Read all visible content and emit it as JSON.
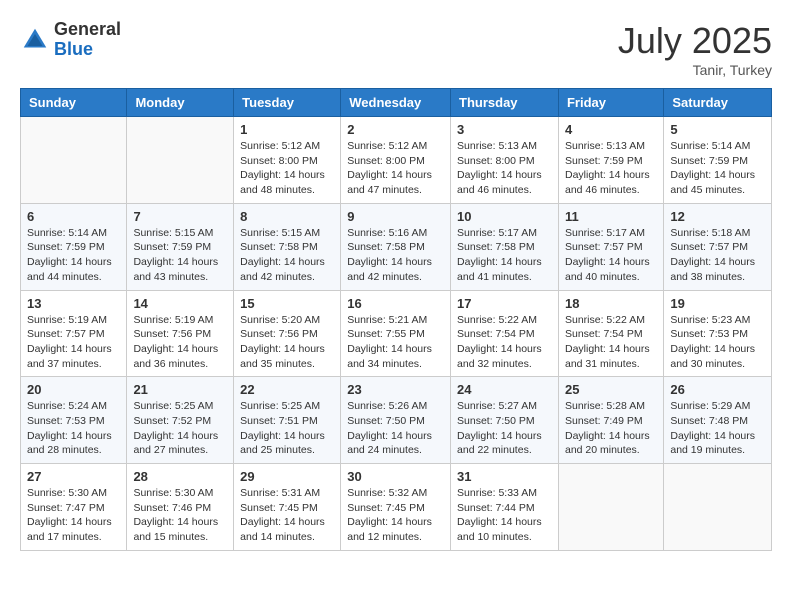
{
  "logo": {
    "general": "General",
    "blue": "Blue"
  },
  "title": {
    "month_year": "July 2025",
    "location": "Tanir, Turkey"
  },
  "headers": [
    "Sunday",
    "Monday",
    "Tuesday",
    "Wednesday",
    "Thursday",
    "Friday",
    "Saturday"
  ],
  "weeks": [
    [
      {
        "day": "",
        "info": ""
      },
      {
        "day": "",
        "info": ""
      },
      {
        "day": "1",
        "info": "Sunrise: 5:12 AM\nSunset: 8:00 PM\nDaylight: 14 hours and 48 minutes."
      },
      {
        "day": "2",
        "info": "Sunrise: 5:12 AM\nSunset: 8:00 PM\nDaylight: 14 hours and 47 minutes."
      },
      {
        "day": "3",
        "info": "Sunrise: 5:13 AM\nSunset: 8:00 PM\nDaylight: 14 hours and 46 minutes."
      },
      {
        "day": "4",
        "info": "Sunrise: 5:13 AM\nSunset: 7:59 PM\nDaylight: 14 hours and 46 minutes."
      },
      {
        "day": "5",
        "info": "Sunrise: 5:14 AM\nSunset: 7:59 PM\nDaylight: 14 hours and 45 minutes."
      }
    ],
    [
      {
        "day": "6",
        "info": "Sunrise: 5:14 AM\nSunset: 7:59 PM\nDaylight: 14 hours and 44 minutes."
      },
      {
        "day": "7",
        "info": "Sunrise: 5:15 AM\nSunset: 7:59 PM\nDaylight: 14 hours and 43 minutes."
      },
      {
        "day": "8",
        "info": "Sunrise: 5:15 AM\nSunset: 7:58 PM\nDaylight: 14 hours and 42 minutes."
      },
      {
        "day": "9",
        "info": "Sunrise: 5:16 AM\nSunset: 7:58 PM\nDaylight: 14 hours and 42 minutes."
      },
      {
        "day": "10",
        "info": "Sunrise: 5:17 AM\nSunset: 7:58 PM\nDaylight: 14 hours and 41 minutes."
      },
      {
        "day": "11",
        "info": "Sunrise: 5:17 AM\nSunset: 7:57 PM\nDaylight: 14 hours and 40 minutes."
      },
      {
        "day": "12",
        "info": "Sunrise: 5:18 AM\nSunset: 7:57 PM\nDaylight: 14 hours and 38 minutes."
      }
    ],
    [
      {
        "day": "13",
        "info": "Sunrise: 5:19 AM\nSunset: 7:57 PM\nDaylight: 14 hours and 37 minutes."
      },
      {
        "day": "14",
        "info": "Sunrise: 5:19 AM\nSunset: 7:56 PM\nDaylight: 14 hours and 36 minutes."
      },
      {
        "day": "15",
        "info": "Sunrise: 5:20 AM\nSunset: 7:56 PM\nDaylight: 14 hours and 35 minutes."
      },
      {
        "day": "16",
        "info": "Sunrise: 5:21 AM\nSunset: 7:55 PM\nDaylight: 14 hours and 34 minutes."
      },
      {
        "day": "17",
        "info": "Sunrise: 5:22 AM\nSunset: 7:54 PM\nDaylight: 14 hours and 32 minutes."
      },
      {
        "day": "18",
        "info": "Sunrise: 5:22 AM\nSunset: 7:54 PM\nDaylight: 14 hours and 31 minutes."
      },
      {
        "day": "19",
        "info": "Sunrise: 5:23 AM\nSunset: 7:53 PM\nDaylight: 14 hours and 30 minutes."
      }
    ],
    [
      {
        "day": "20",
        "info": "Sunrise: 5:24 AM\nSunset: 7:53 PM\nDaylight: 14 hours and 28 minutes."
      },
      {
        "day": "21",
        "info": "Sunrise: 5:25 AM\nSunset: 7:52 PM\nDaylight: 14 hours and 27 minutes."
      },
      {
        "day": "22",
        "info": "Sunrise: 5:25 AM\nSunset: 7:51 PM\nDaylight: 14 hours and 25 minutes."
      },
      {
        "day": "23",
        "info": "Sunrise: 5:26 AM\nSunset: 7:50 PM\nDaylight: 14 hours and 24 minutes."
      },
      {
        "day": "24",
        "info": "Sunrise: 5:27 AM\nSunset: 7:50 PM\nDaylight: 14 hours and 22 minutes."
      },
      {
        "day": "25",
        "info": "Sunrise: 5:28 AM\nSunset: 7:49 PM\nDaylight: 14 hours and 20 minutes."
      },
      {
        "day": "26",
        "info": "Sunrise: 5:29 AM\nSunset: 7:48 PM\nDaylight: 14 hours and 19 minutes."
      }
    ],
    [
      {
        "day": "27",
        "info": "Sunrise: 5:30 AM\nSunset: 7:47 PM\nDaylight: 14 hours and 17 minutes."
      },
      {
        "day": "28",
        "info": "Sunrise: 5:30 AM\nSunset: 7:46 PM\nDaylight: 14 hours and 15 minutes."
      },
      {
        "day": "29",
        "info": "Sunrise: 5:31 AM\nSunset: 7:45 PM\nDaylight: 14 hours and 14 minutes."
      },
      {
        "day": "30",
        "info": "Sunrise: 5:32 AM\nSunset: 7:45 PM\nDaylight: 14 hours and 12 minutes."
      },
      {
        "day": "31",
        "info": "Sunrise: 5:33 AM\nSunset: 7:44 PM\nDaylight: 14 hours and 10 minutes."
      },
      {
        "day": "",
        "info": ""
      },
      {
        "day": "",
        "info": ""
      }
    ]
  ]
}
